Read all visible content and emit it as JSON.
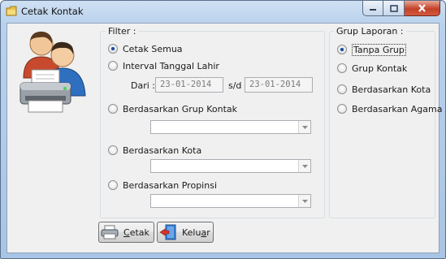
{
  "window": {
    "title": "Cetak Kontak"
  },
  "filter": {
    "title": "Filter :",
    "cetak_semua": "Cetak Semua",
    "interval_tanggal_lahir": "Interval Tanggal Lahir",
    "dari_label": "Dari :",
    "dari_value": "23-01-2014",
    "sd_label": "s/d",
    "sd_value": "23-01-2014",
    "grup_kontak": "Berdasarkan Grup Kontak",
    "kota": "Berdasarkan Kota",
    "propinsi": "Berdasarkan Propinsi",
    "selected": "Cetak Semua"
  },
  "grup_laporan": {
    "title": "Grup Laporan :",
    "items": [
      "Tanpa Grup",
      "Grup Kontak",
      "Berdasarkan Kota",
      "Berdasarkan Agama"
    ],
    "selected": "Tanpa Grup"
  },
  "buttons": {
    "cetak_mnemonic": "C",
    "cetak_rest": "etak",
    "keluar_first": "Kelu",
    "keluar_mnemonic": "a",
    "keluar_rest": "r"
  },
  "colors": {
    "title_bar": "#b9d1ec",
    "client_bg": "#f0f0f0",
    "close_button": "#c24128",
    "radio_dot": "#1f4d9c"
  },
  "icons": [
    "folder-icon",
    "minimize-icon",
    "maximize-icon",
    "close-icon",
    "contacts-printer-icon",
    "printer-icon",
    "exit-door-icon",
    "dropdown-arrow-icon"
  ]
}
